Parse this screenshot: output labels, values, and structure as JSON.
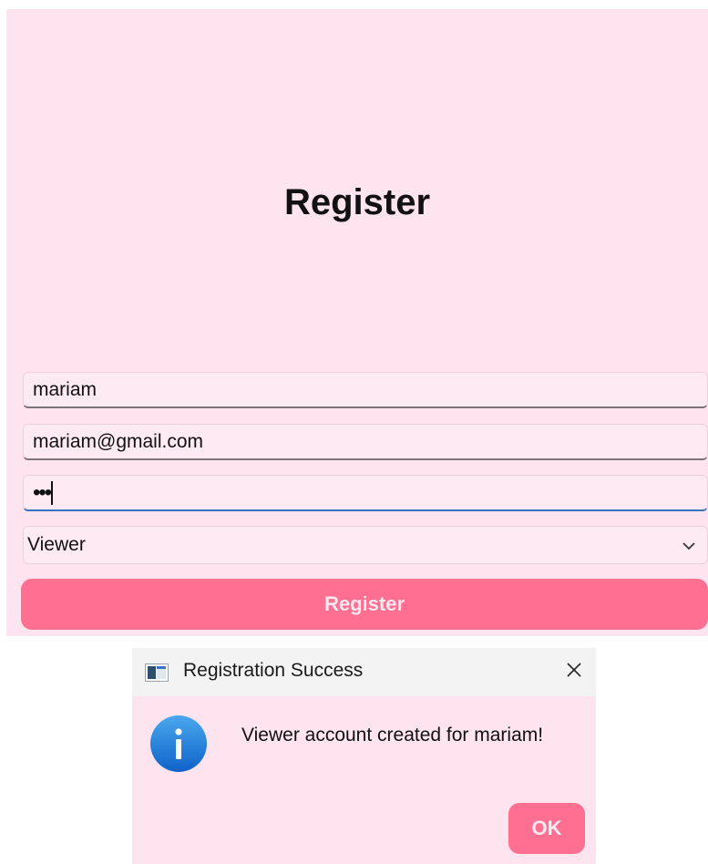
{
  "register_form": {
    "title": "Register",
    "username_value": "mariam",
    "email_value": "mariam@gmail.com",
    "password_mask": "•••",
    "role_selected": "Viewer",
    "submit_label": "Register"
  },
  "dialog": {
    "title": "Registration Success",
    "message": "Viewer account created for mariam!",
    "ok_label": "OK",
    "icon": "info-icon"
  },
  "colors": {
    "background": "#fde4ee",
    "accent": "#ff6f91",
    "focus": "#3a73c4"
  }
}
